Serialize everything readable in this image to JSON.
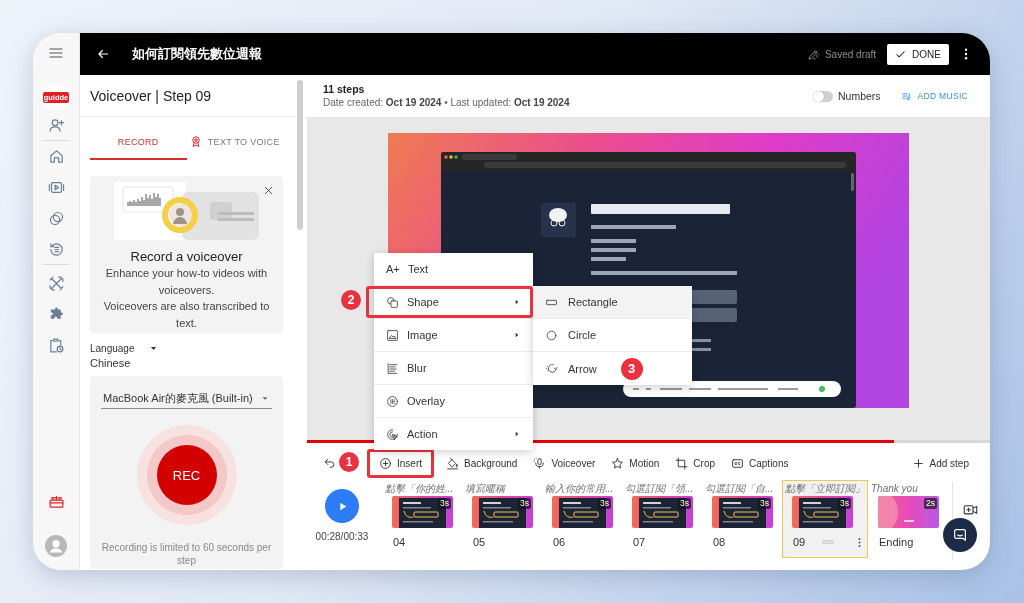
{
  "app_rail": {
    "logo": "guidde"
  },
  "top_bar": {
    "title": "如何訂閱領先數位週報",
    "save_status": "Saved draft",
    "done_button": "DONE"
  },
  "voiceover_panel": {
    "title": "Voiceover | Step 09",
    "tabs": [
      {
        "label": "RECORD",
        "selected": true
      },
      {
        "label": "TEXT TO VOICE",
        "selected": false
      }
    ],
    "promo": {
      "title": "Record a voiceover",
      "paragraphs": [
        "Enhance your how-to videos with voiceovers.",
        "Voiceovers are also transcribed to text."
      ]
    },
    "language": {
      "label": "Language",
      "value": "Chinese"
    },
    "microphone": {
      "value": "MacBook Air的麥克風 (Built-in)"
    },
    "record_button": "REC",
    "note": "Recording is limited to 60 seconds per step"
  },
  "editor": {
    "steps_count": "11 steps",
    "dates": "Date created: **Oct 19 2024** • Last updated: **Oct 19 2024**",
    "numbers_toggle": {
      "label": "Numbers",
      "on": false
    },
    "add_music": "ADD MUSIC",
    "playback": {
      "level": 0.86
    }
  },
  "insert_menu": {
    "items": [
      {
        "glyph": "A+",
        "label": "Text",
        "has_submenu": false,
        "outlined": false
      },
      {
        "label": "Shape",
        "has_submenu": true,
        "outlined": true,
        "callout": "2",
        "submenu": [
          {
            "label": "Rectangle",
            "highlighted": true
          },
          {
            "label": "Circle",
            "highlighted": false
          },
          {
            "label": "Arrow",
            "highlighted": false,
            "callout": "3"
          }
        ]
      },
      {
        "label": "Image",
        "has_submenu": true,
        "outlined": false
      },
      {
        "label": "Blur",
        "has_submenu": false,
        "outlined": false
      },
      {
        "label": "Overlay",
        "has_submenu": false,
        "outlined": false
      },
      {
        "label": "Action",
        "has_submenu": true,
        "outlined": false
      }
    ]
  },
  "toolbar": {
    "tools": [
      {
        "label": "Insert",
        "outlined": true,
        "callout": "1"
      },
      {
        "label": "Background",
        "outlined": false
      },
      {
        "label": "Voiceover",
        "outlined": false
      },
      {
        "label": "Motion",
        "outlined": false
      },
      {
        "label": "Crop",
        "outlined": false
      },
      {
        "label": "Captions",
        "outlined": false
      }
    ],
    "add_step": "Add step"
  },
  "timeline": {
    "time": "00:28/00:33",
    "steps": [
      {
        "kind": "step",
        "caption": "點擊「你的姓...",
        "duration": "3s",
        "number": "04",
        "selected": false
      },
      {
        "kind": "step",
        "caption": "填寫暱稱",
        "duration": "3s",
        "number": "05",
        "selected": false
      },
      {
        "kind": "step",
        "caption": "輸入你的常用...",
        "duration": "3s",
        "number": "06",
        "selected": false
      },
      {
        "kind": "step",
        "caption": "勾選訂閱「領...",
        "duration": "3s",
        "number": "07",
        "selected": false
      },
      {
        "kind": "step",
        "caption": "勾選訂閱「自...",
        "duration": "3s",
        "number": "08",
        "selected": false
      },
      {
        "kind": "step",
        "caption": "點擊「立即訂閱」",
        "duration": "3s",
        "number": "09",
        "selected": true
      },
      {
        "kind": "ending",
        "caption": "Thank you",
        "duration": "2s",
        "number": "Ending",
        "selected": false
      }
    ]
  }
}
